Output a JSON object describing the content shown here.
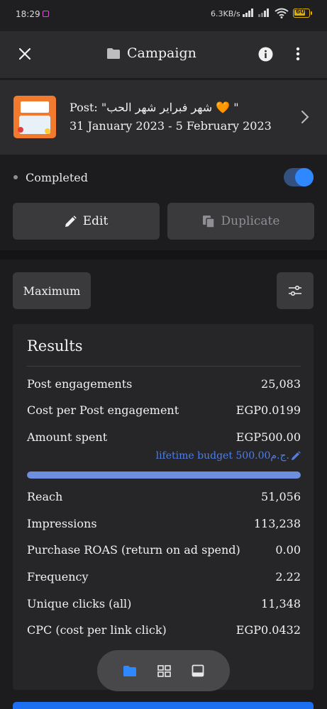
{
  "status_bar": {
    "time": "18:29",
    "network_speed": "6.3KB/s",
    "battery": "60"
  },
  "header": {
    "title": "Campaign",
    "icons": [
      "close-icon",
      "folder-icon",
      "info-icon",
      "more-vert-icon"
    ]
  },
  "post": {
    "title": "Post: \"شهر فبراير شهر الحب 🧡 \"",
    "dates": "31 January 2023 - 5 February 2023"
  },
  "status": {
    "label": "Completed",
    "toggle_on": true
  },
  "actions": {
    "edit_label": "Edit",
    "duplicate_label": "Duplicate"
  },
  "filter": {
    "maximum_label": "Maximum"
  },
  "results": {
    "title": "Results",
    "metrics": [
      {
        "label": "Post engagements",
        "value": "25,083"
      },
      {
        "label": "Cost per Post engagement",
        "value": "EGP0.0199"
      },
      {
        "label": "Amount spent",
        "value": "EGP500.00"
      },
      {
        "label": "Reach",
        "value": "51,056"
      },
      {
        "label": "Impressions",
        "value": "113,238"
      },
      {
        "label": "Purchase ROAS (return on ad spend)",
        "value": "0.00"
      },
      {
        "label": "Frequency",
        "value": "2.22"
      },
      {
        "label": "Unique clicks (all)",
        "value": "11,348"
      },
      {
        "label": "CPC (cost per link click)",
        "value": "EGP0.0432"
      }
    ],
    "budget_text": "lifetime budget 500.00ج.م.",
    "spent_fraction": 1.0
  },
  "colors": {
    "accent": "#2f88ff",
    "link": "#4f7ee8",
    "progress": "#6e8ee0",
    "nav_active": "#2f88ff"
  }
}
